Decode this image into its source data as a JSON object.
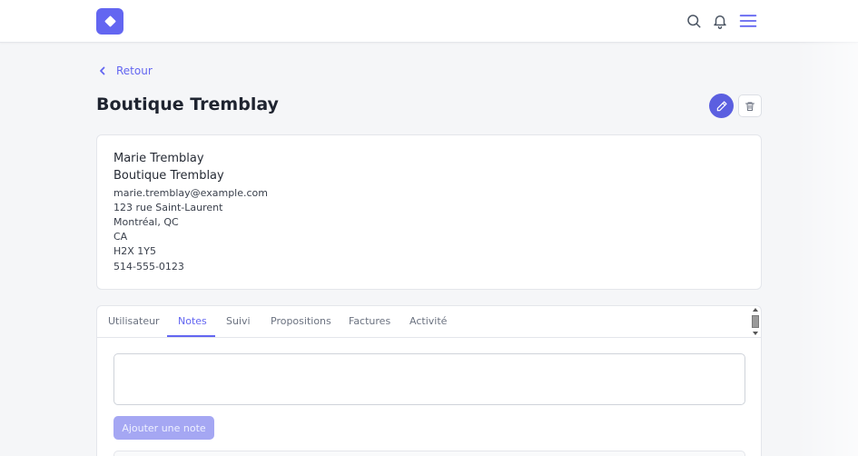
{
  "header": {
    "logo_icon": "diamond-icon",
    "icons": [
      "search-icon",
      "bell-icon",
      "menu-icon"
    ],
    "accent_color": "#6366f1"
  },
  "back_link": {
    "label": "Retour"
  },
  "page_title": "Boutique Tremblay",
  "actions": {
    "edit_icon": "pencil-icon",
    "delete_icon": "trash-icon"
  },
  "contact": {
    "name": "Marie Tremblay",
    "company": "Boutique Tremblay",
    "email": "marie.tremblay@example.com",
    "street": "123 rue Saint-Laurent",
    "city": "Montréal, QC",
    "country": "CA",
    "postal_code": "H2X 1Y5",
    "phone": "514-555-0123"
  },
  "tabs": [
    {
      "label": "Utilisateur",
      "active": false
    },
    {
      "label": "Notes",
      "active": true
    },
    {
      "label": "Suivi",
      "active": false
    },
    {
      "label": "Propositions",
      "active": false
    },
    {
      "label": "Factures",
      "active": false
    },
    {
      "label": "Activité",
      "active": false
    }
  ],
  "notes": {
    "input_value": "",
    "input_placeholder": "",
    "add_button_label": "Ajouter une note"
  }
}
